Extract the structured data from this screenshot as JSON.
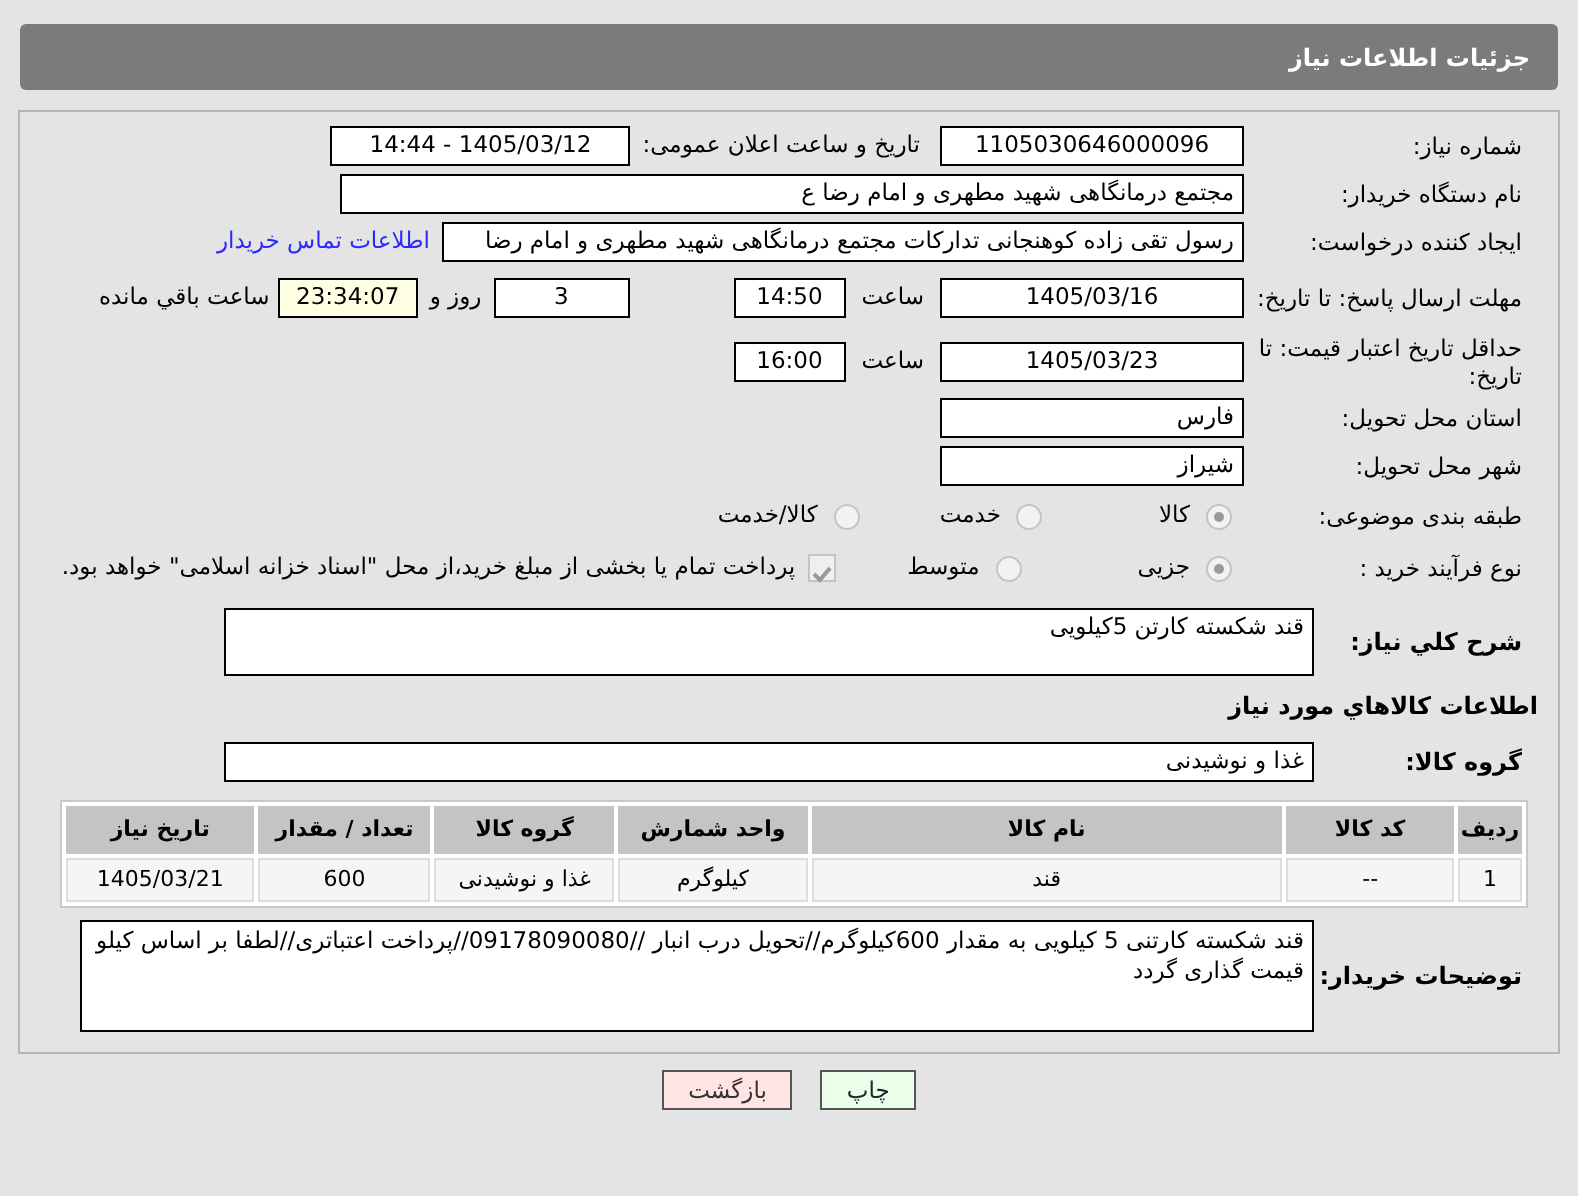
{
  "header": {
    "title": "جزئیات اطلاعات نیاز"
  },
  "need_number": {
    "label": "شماره نیاز:",
    "value": "1105030646000096"
  },
  "announce": {
    "label": "تاریخ و ساعت اعلان عمومی:",
    "value": "1405/03/12 - 14:44"
  },
  "buyer_org": {
    "label": "نام دستگاه خریدار:",
    "value": "مجتمع درمانگاهی شهید مطهری و امام رضا  ع"
  },
  "creator": {
    "label": "ایجاد کننده درخواست:",
    "value": "رسول تقی زاده کوهنجانی تدارکات مجتمع درمانگاهی شهید مطهری و امام رضا",
    "link": "اطلاعات تماس خریدار"
  },
  "deadline": {
    "label": "مهلت ارسال پاسخ: تا تاریخ:",
    "date": "1405/03/16",
    "time_label": "ساعت",
    "time": "14:50",
    "days": "3",
    "days_label": "روز و",
    "remaining": "23:34:07",
    "remaining_label": "ساعت باقي مانده"
  },
  "validity": {
    "label": "حداقل تاریخ اعتبار قیمت: تا تاریخ:",
    "date": "1405/03/23",
    "time_label": "ساعت",
    "time": "16:00"
  },
  "province": {
    "label": "استان محل تحویل:",
    "value": "فارس"
  },
  "city": {
    "label": "شهر محل تحویل:",
    "value": "شیراز"
  },
  "category": {
    "label": "طبقه بندی موضوعی:",
    "options": [
      {
        "label": "کالا",
        "selected": true
      },
      {
        "label": "خدمت",
        "selected": false
      },
      {
        "label": "کالا/خدمت",
        "selected": false
      }
    ]
  },
  "purchase_type": {
    "label": "نوع فرآیند خرید :",
    "options": [
      {
        "label": "جزیی",
        "selected": true
      },
      {
        "label": "متوسط",
        "selected": false
      }
    ],
    "payment": {
      "label": "پرداخت تمام یا بخشی از مبلغ خرید،از محل \"اسناد خزانه اسلامی\" خواهد بود.",
      "checked": true
    }
  },
  "description": {
    "label": "شرح كلي نياز:",
    "value": "قند شکسته کارتن 5کیلویی"
  },
  "goods_title": "اطلاعات كالاهاي مورد نياز",
  "goods_group": {
    "label": "گروه کالا:",
    "value": "غذا و نوشیدنی"
  },
  "table": {
    "columns": [
      "ردیف",
      "کد کالا",
      "نام کالا",
      "واحد شمارش",
      "گروه کالا",
      "تعداد / مقدار",
      "تاریخ نیاز"
    ],
    "rows": [
      [
        "1",
        "--",
        "قند",
        "کیلوگرم",
        "غذا و نوشیدنی",
        "600",
        "1405/03/21"
      ]
    ]
  },
  "buyer_notes": {
    "label": "توضیحات خریدار:",
    "value": "قند شکسته کارتنی 5 کیلویی به مقدار 600کیلوگرم//تحویل درب انبار //09178090080//پرداخت اعتباتری//لطفا بر اساس کیلو قیمت گذاری گردد"
  },
  "buttons": [
    {
      "label": "چاپ",
      "kind": "print"
    },
    {
      "label": "بازگشت",
      "kind": "back"
    }
  ]
}
